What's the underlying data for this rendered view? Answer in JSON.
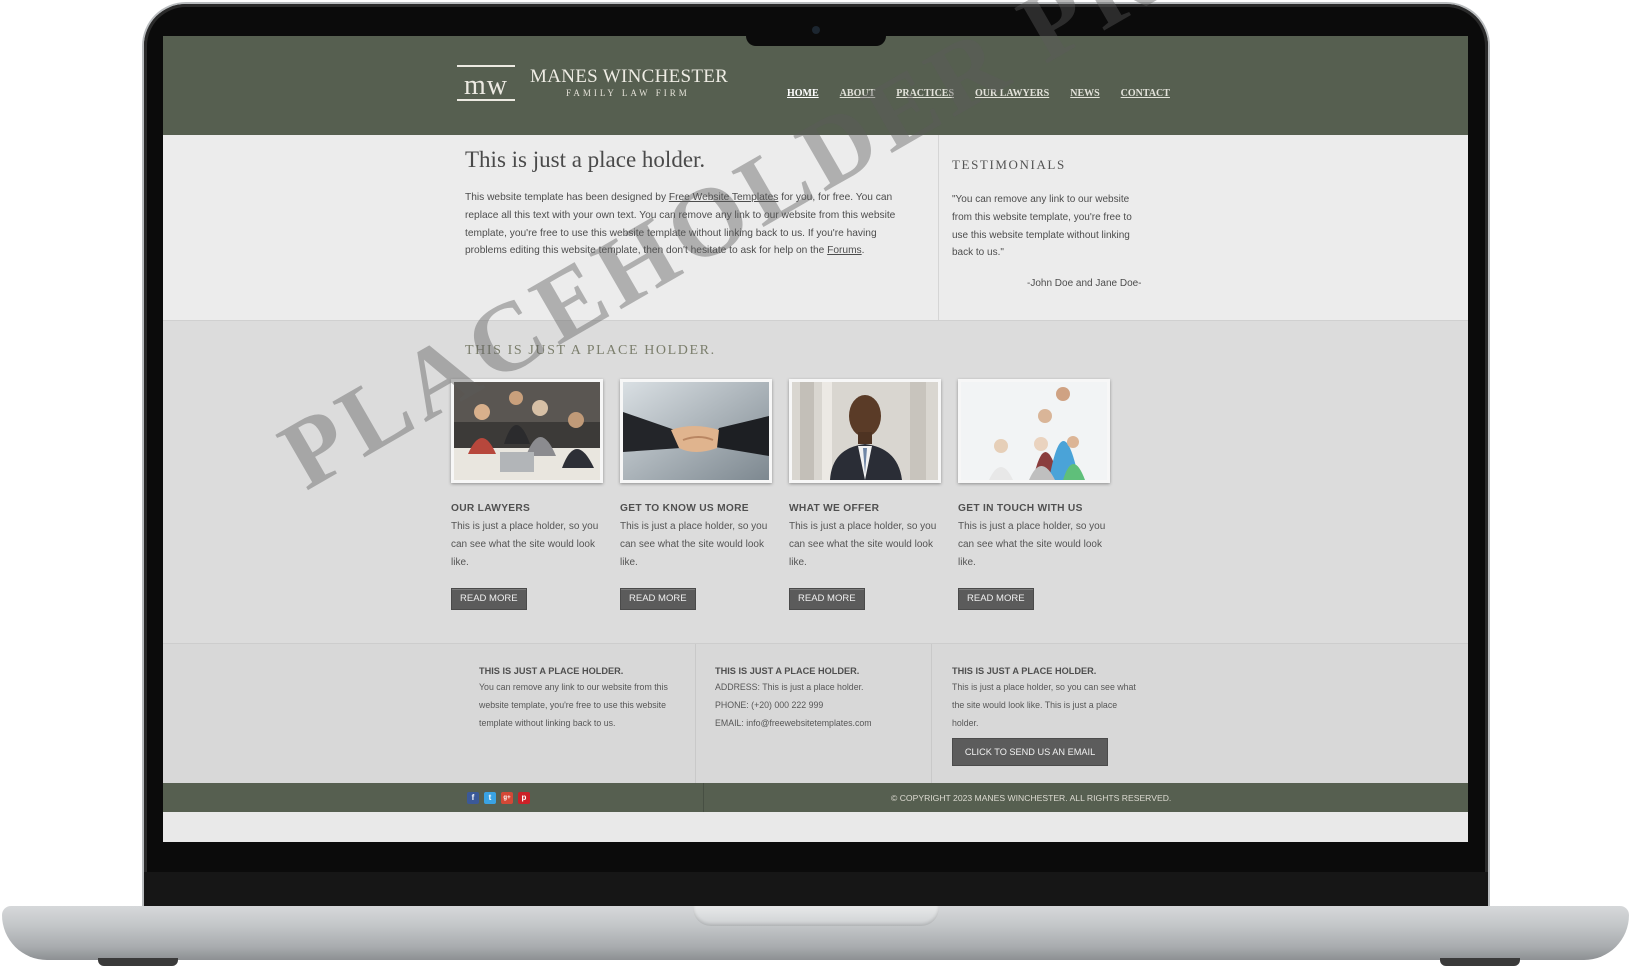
{
  "brand": {
    "monogram": "MW",
    "name": "MANES WINCHESTER",
    "tagline": "FAMILY LAW FIRM"
  },
  "nav": [
    {
      "label": "HOME",
      "active": true
    },
    {
      "label": "ABOUT"
    },
    {
      "label": "PRACTICES"
    },
    {
      "label": "OUR LAWYERS"
    },
    {
      "label": "NEWS"
    },
    {
      "label": "CONTACT"
    }
  ],
  "intro": {
    "title": "This is just a place holder.",
    "text_1": "This website template has been designed by ",
    "link_1": "Free Website Templates",
    "text_2": " for you, for free. You can replace all this text with your own text. You can remove any link to our website from this website template, you're free to use this website template without linking back to us. If you're having problems editing this website template, then don't hesitate to ask for help on the ",
    "link_2": "Forums",
    "text_3": "."
  },
  "testimonials": {
    "heading": "TESTIMONIALS",
    "quote": "\"You can remove any link to our website from this website template, you're free to use this website template without linking back to us.\"",
    "author": "-John Doe and Jane Doe-"
  },
  "features": {
    "heading": "THIS IS JUST A PLACE HOLDER.",
    "cards": [
      {
        "title": "OUR LAWYERS",
        "text": "This is just a place holder, so you can see what the site would look like.",
        "button": "READ MORE",
        "image": "meeting-photo"
      },
      {
        "title": "GET TO KNOW US MORE",
        "text": "This is just a place holder, so you can see what the site would look like.",
        "button": "READ MORE",
        "image": "handshake-photo"
      },
      {
        "title": "WHAT WE OFFER",
        "text": "This is just a place holder, so you can see what the site would look like.",
        "button": "READ MORE",
        "image": "lawyer-portrait-photo"
      },
      {
        "title": "GET IN TOUCH WITH US",
        "text": "This is just a place holder, so you can see what the site would look like.",
        "button": "READ MORE",
        "image": "family-photo"
      }
    ]
  },
  "footer_info": {
    "col1": {
      "title": "THIS IS JUST A PLACE HOLDER.",
      "text": "You can remove any link to our website from this website template, you're free to use this website template without linking back to us."
    },
    "col2": {
      "title": "THIS IS JUST A PLACE HOLDER.",
      "address": "ADDRESS: This is just a place holder.",
      "phone": "PHONE: (+20) 000 222 999",
      "email": "EMAIL: info@freewebsitetemplates.com"
    },
    "col3": {
      "title": "THIS IS JUST A PLACE HOLDER.",
      "text": "This is just a place holder, so you can see what the site would look like. This is just a place holder.",
      "button": "CLICK TO SEND US AN EMAIL"
    }
  },
  "social": [
    {
      "icon": "facebook-icon",
      "glyph": "f",
      "color": "#3b5998"
    },
    {
      "icon": "twitter-icon",
      "glyph": "t",
      "color": "#3aa3e3"
    },
    {
      "icon": "google-plus-icon",
      "glyph": "g+",
      "color": "#d34836"
    },
    {
      "icon": "pinterest-icon",
      "glyph": "p",
      "color": "#cb2027"
    }
  ],
  "copyright": "© COPYRIGHT 2023 MANES WINCHESTER. ALL RIGHTS RESERVED.",
  "watermark": "PLACEHOLDER PROJECT",
  "colors": {
    "header": "#565f50",
    "intro_bg": "#ececec",
    "features_bg": "#dcdcdc",
    "button": "#5b5b5b"
  }
}
